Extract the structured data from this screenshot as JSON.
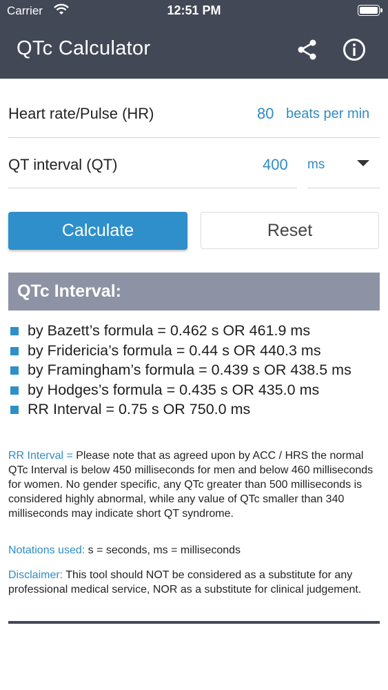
{
  "status_bar": {
    "carrier": "Carrier",
    "time": "12:51 PM"
  },
  "app_bar": {
    "title": "QTc Calculator",
    "share_icon": "share-icon",
    "info_icon": "info-icon"
  },
  "inputs": {
    "hr": {
      "label": "Heart rate/Pulse (HR)",
      "value": "80",
      "unit": "beats per min"
    },
    "qt": {
      "label": "QT interval (QT)",
      "value": "400",
      "unit": "ms"
    }
  },
  "buttons": {
    "calculate": "Calculate",
    "reset": "Reset"
  },
  "results": {
    "heading": "QTc Interval:",
    "items": [
      "by Bazett’s formula = 0.462 s OR 461.9 ms",
      "by Fridericia’s formula = 0.44 s OR 440.3 ms",
      "by Framingham’s formula = 0.439 s OR 438.5 ms",
      "by Hodges’s formula = 0.435 s OR 435.0 ms",
      "RR Interval = 0.75 s OR 750.0 ms"
    ]
  },
  "notes": {
    "rr": {
      "key": "RR Interval =",
      "text": " Please note that as agreed upon by ACC / HRS the normal QTc Interval is below 450 milliseconds for men and below 460 milliseconds for women. No gender specific, any QTc greater than 500 milliseconds is considered highly abnormal, while any value of QTc smaller than 340 milliseconds may indicate short QT syndrome."
    },
    "notations": {
      "key": "Notations used:",
      "text": " s = seconds, ms = milliseconds"
    },
    "disclaimer": {
      "key": "Disclaimer:",
      "text": " This tool should NOT be considered as a substitute for any professional medical service, NOR as a substitute for clinical judgement."
    }
  },
  "colors": {
    "appbar": "#434856",
    "accent": "#2e8fca",
    "section_head": "#8d93a4"
  }
}
